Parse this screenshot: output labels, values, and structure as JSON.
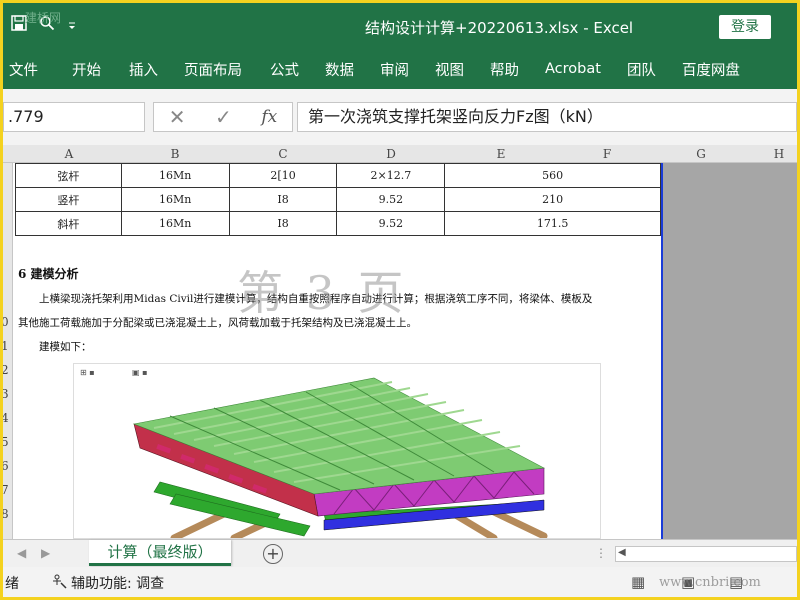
{
  "window": {
    "title": "结构设计计算+20220613.xlsx  -  Excel",
    "login_label": "登录",
    "watermark": "建桥网"
  },
  "ribbon": {
    "tabs": [
      "文件",
      "开始",
      "插入",
      "页面布局",
      "公式",
      "数据",
      "审阅",
      "视图",
      "帮助",
      "Acrobat",
      "团队",
      "百度网盘"
    ]
  },
  "formula_bar": {
    "name_box": ".779",
    "content": "第一次浇筑支撑托架竖向反力Fz图（kN）"
  },
  "columns": [
    "A",
    "B",
    "C",
    "D",
    "E",
    "F",
    "G",
    "H"
  ],
  "rows": [
    "0",
    "1",
    "2",
    "3",
    "4",
    "5",
    "6",
    "7",
    "8"
  ],
  "table": {
    "rows": [
      {
        "name": "弦杆",
        "material": "16Mn",
        "section": "2[10",
        "dim": "2×12.7",
        "value": "560"
      },
      {
        "name": "竖杆",
        "material": "16Mn",
        "section": "I8",
        "dim": "9.52",
        "value": "210"
      },
      {
        "name": "斜杆",
        "material": "16Mn",
        "section": "I8",
        "dim": "9.52",
        "value": "171.5"
      }
    ]
  },
  "document": {
    "section_title": "6 建模分析",
    "para_line1": "上横梁现浇托架利用Midas Civil进行建模计算，结构自重按照程序自动进行计算；根据浇筑工序不同，将梁体、模板及",
    "para_line2": "其他施工荷载施加于分配梁或已浇混凝土上，风荷载加载于托架结构及已浇混凝土上。",
    "para_line3": "建模如下：",
    "page_watermark": "第 3 页"
  },
  "sheet_bar": {
    "active_tab": "计算（最终版）",
    "add_label": "+",
    "nav_prev": "◀",
    "nav_next": "▶",
    "scroll_left": "◀"
  },
  "status_bar": {
    "mode": "绪",
    "accessibility": "辅助功能: 调查",
    "watermark": "www.cnbri.com"
  },
  "colors": {
    "excel_green": "#217346",
    "sheet_border_blue": "#1a3cd8",
    "outer_frame": "#f4d21f"
  }
}
